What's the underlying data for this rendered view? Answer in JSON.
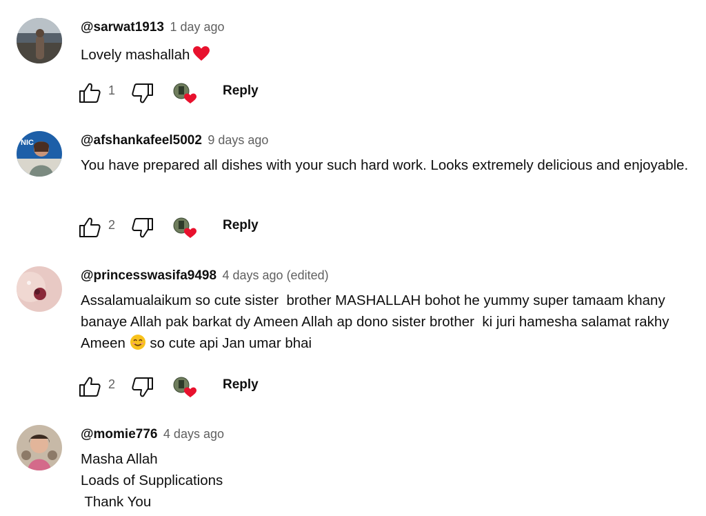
{
  "comments": [
    {
      "author": "@sarwat1913",
      "time": "1 day ago",
      "text": "Lovely mashallah",
      "likes": "1",
      "reply_label": "Reply",
      "emoji": "heart"
    },
    {
      "author": "@afshankafeel5002",
      "time": "9 days ago",
      "text": "You have prepared all dishes with your such hard work. Looks extremely delicious and enjoyable.",
      "likes": "2",
      "reply_label": "Reply"
    },
    {
      "author": "@princesswasifa9498",
      "time": "4 days ago (edited)",
      "text_before_emoji": "Assalamualaikum so cute sister  brother MASHALLAH bohot he yummy super tamaam khany  banaye Allah pak barkat dy Ameen Allah ap dono sister brother  ki juri hamesha salamat rakhy Ameen ",
      "text_after_emoji": " so cute api Jan umar bhai",
      "emoji": "smiling-face",
      "likes": "2",
      "reply_label": "Reply"
    },
    {
      "author": "@momie776",
      "time": "4 days ago",
      "text": "Masha Allah\nLoads of Supplications\n Thank You"
    }
  ],
  "icons": {
    "like": "thumbs-up-icon",
    "dislike": "thumbs-down-icon",
    "creator_heart": "creator-heart-icon"
  },
  "colors": {
    "author": "#0f0f0f",
    "time": "#606060",
    "heart": "#e8112d"
  }
}
